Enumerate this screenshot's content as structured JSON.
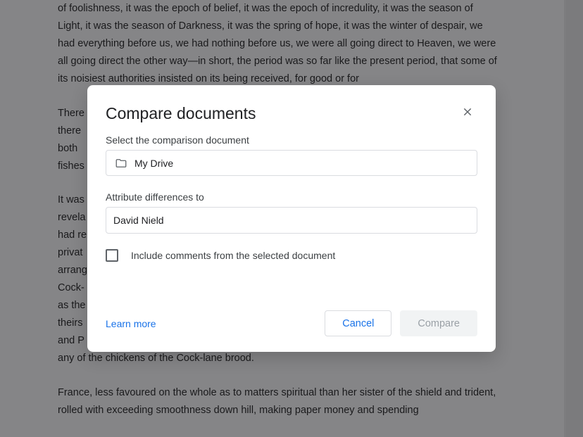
{
  "document": {
    "paragraphs": [
      "of foolishness, it was the epoch of belief, it was the epoch of incredulity, it was the season of Light, it was the season of Darkness, it was the spring of hope, it was the winter of despair, we had everything before us, we had nothing before us, we were all going direct to Heaven, we were all going direct the other way—in short, the period was so far like the present period, that some of its noisiest authorities insisted on its being received, for good or for",
      "There\nthere\nboth\nfishes",
      "It was\nrevela\nhad re\nprivat\narrang\nCock-\nas the\ntheirs\nand P                                                                                                                                       proved more important to the human race than any communications yet received through any of the chickens of the Cock-lane brood.",
      "France, less favoured on the whole as to matters spiritual than her sister of the shield and trident, rolled with exceeding smoothness down hill, making paper money and spending"
    ]
  },
  "dialog": {
    "title": "Compare documents",
    "select_label": "Select the comparison document",
    "picker_text": "My Drive",
    "attribute_label": "Attribute differences to",
    "attribute_value": "David Nield",
    "checkbox_label": "Include comments from the selected document",
    "learn_more": "Learn more",
    "cancel": "Cancel",
    "compare": "Compare"
  }
}
